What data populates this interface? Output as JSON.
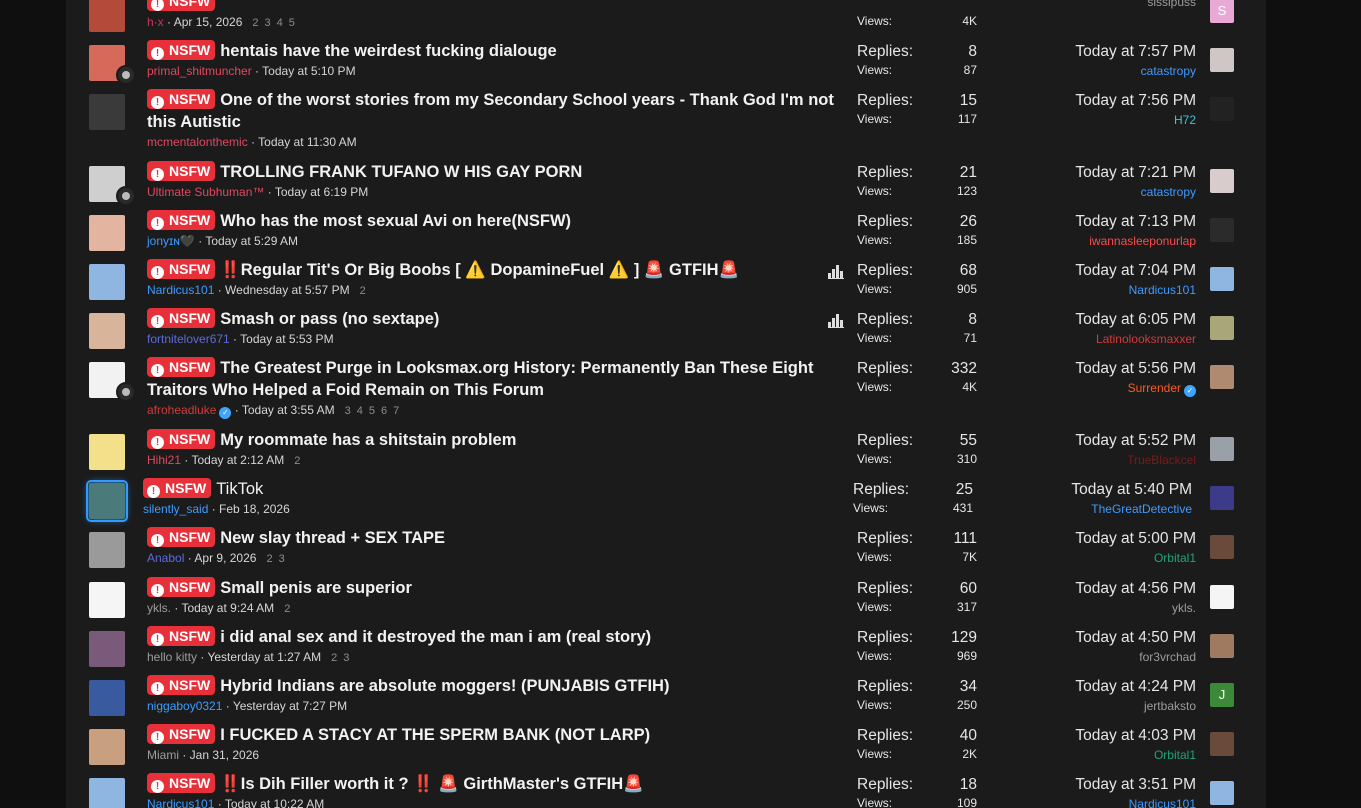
{
  "labels": {
    "tag": "NSFW",
    "replies": "Replies:",
    "views": "Views:"
  },
  "colors": {
    "tag_bg": "#e8303a",
    "accent_blue": "#3ea5ff"
  },
  "threads": [
    {
      "title": "",
      "author": "h·x",
      "author_color": "#c9355a",
      "started": "Apr 15, 2026",
      "pages": [
        "2",
        "3",
        "4",
        "5"
      ],
      "replies": "",
      "views": "4K",
      "last_time": "",
      "last_user": "sissipuss",
      "last_user_color": "#9c9c9c",
      "avatar_color": "#b34a3a",
      "last_avatar_color": "#e9a9d6",
      "last_avatar_letter": "S",
      "height": "h49"
    },
    {
      "title": "hentais have the weirdest fucking dialouge",
      "author": "primal_shitmuncher",
      "author_color": "#e0475f",
      "started": "Today at 5:10 PM",
      "pages": [],
      "replies": "8",
      "views": "87",
      "last_time": "Today at 7:57 PM",
      "last_user": "catastropy",
      "last_user_color": "#3e9bff",
      "avatar_color": "#d66a5a",
      "last_avatar_color": "#cfc6c6",
      "has_mini": true,
      "height": "h49"
    },
    {
      "title": "One of the worst stories from my Secondary School years - Thank God I'm not this Autistic",
      "author": "mcmentalonthemic",
      "author_color": "#e0475f",
      "started": "Today at 11:30 AM",
      "pages": [],
      "replies": "15",
      "views": "117",
      "last_time": "Today at 7:56 PM",
      "last_user": "H72",
      "last_user_color": "#3ec1d6",
      "avatar_color": "#3a3a3a",
      "last_avatar_color": "#222",
      "height": "h72"
    },
    {
      "title": "TROLLING FRANK TUFANO W HIS GAY PORN",
      "author": "Ultimate Subhuman™",
      "author_color": "#e0475f",
      "started": "Today at 6:19 PM",
      "pages": [],
      "replies": "21",
      "views": "123",
      "last_time": "Today at 7:21 PM",
      "last_user": "catastropy",
      "last_user_color": "#3e9bff",
      "avatar_color": "#cfcfcf",
      "last_avatar_color": "#d9cccc",
      "has_mini": true,
      "height": "h49"
    },
    {
      "title": "Who has the most sexual Avi on here(NSFW)",
      "author": "jonyɪɴ🖤",
      "author_color": "#3e9bff",
      "started": "Today at 5:29 AM",
      "pages": [],
      "replies": "26",
      "views": "185",
      "last_time": "Today at 7:13 PM",
      "last_user": "iwannasleeponurlap",
      "last_user_color": "#ff4a4a",
      "avatar_color": "#e3b4a0",
      "last_avatar_color": "#2b2b2b",
      "height": "h49"
    },
    {
      "title": "‼️Regular Tit's Or Big Boobs [ ⚠️ DopamineFuel ⚠️ ] 🚨 GTFIH🚨",
      "author": "Nardicus101",
      "author_color": "#3e9bff",
      "started": "Wednesday at 5:57 PM",
      "pages": [
        "2"
      ],
      "replies": "68",
      "views": "905",
      "last_time": "Today at 7:04 PM",
      "last_user": "Nardicus101",
      "last_user_color": "#3e9bff",
      "avatar_color": "#8fb6e0",
      "last_avatar_color": "#8fb6e0",
      "poll": true,
      "height": "h49"
    },
    {
      "title": "Smash or pass (no sextape)",
      "author": "fortnitelover671",
      "author_color": "#5d6bd9",
      "started": "Today at 5:53 PM",
      "pages": [],
      "replies": "8",
      "views": "71",
      "last_time": "Today at 6:05 PM",
      "last_user": "Latinolooksmaxxer",
      "last_user_color": "#d23a3a",
      "avatar_color": "#d8b49a",
      "last_avatar_color": "#a9a77a",
      "poll": true,
      "height": "h49"
    },
    {
      "title": "The Greatest Purge in Looksmax.org History: Permanently Ban These Eight Traitors Who Helped a Foid Remain on This Forum",
      "author": "afroheadluke",
      "author_color": "#d23a3a",
      "verified": true,
      "started": "Today at 3:55 AM",
      "pages": [
        "3",
        "4",
        "5",
        "6",
        "7"
      ],
      "replies": "332",
      "views": "4K",
      "last_time": "Today at 5:56 PM",
      "last_user": "Surrender",
      "last_user_color": "#ff5a1f",
      "last_verified": true,
      "avatar_color": "#f2f2f2",
      "last_avatar_color": "#b08a70",
      "has_mini": true,
      "height": "h72"
    },
    {
      "title": "My roommate has a shitstain problem",
      "author": "Hihi21",
      "author_color": "#e0475f",
      "started": "Today at 2:12 AM",
      "pages": [
        "2"
      ],
      "replies": "55",
      "views": "310",
      "last_time": "Today at 5:52 PM",
      "last_user": "TrueBlackcel",
      "last_user_color": "#7a1a1a",
      "avatar_color": "#f2e08a",
      "last_avatar_color": "#9aa0a8",
      "height": "h49"
    },
    {
      "title": "TikTok",
      "author": "silently_said",
      "author_color": "#3e9bff",
      "started": "Feb 18, 2026",
      "pages": [],
      "replies": "25",
      "views": "431",
      "last_time": "Today at 5:40 PM",
      "last_user": "TheGreatDetective",
      "last_user_color": "#3e9bff",
      "avatar_color": "#4a7a7a",
      "last_avatar_color": "#3b3b8a",
      "focus": true,
      "plain_title": true,
      "height": "h49"
    },
    {
      "title": "New slay thread + SEX TAPE",
      "author": "Anabol",
      "author_color": "#5d6bd9",
      "started": "Apr 9, 2026",
      "pages": [
        "2",
        "3"
      ],
      "replies": "111",
      "views": "7K",
      "last_time": "Today at 5:00 PM",
      "last_user": "Orbital1",
      "last_user_color": "#1fa37a",
      "avatar_color": "#9a9a9a",
      "last_avatar_color": "#6a4a3a",
      "height": "h50"
    },
    {
      "title": "Small penis are superior",
      "author": "ykls.",
      "author_color": "#9c9c9c",
      "started": "Today at 9:24 AM",
      "pages": [
        "2"
      ],
      "replies": "60",
      "views": "317",
      "last_time": "Today at 4:56 PM",
      "last_user": "ykls.",
      "last_user_color": "#9c9c9c",
      "avatar_color": "#f5f5f5",
      "last_avatar_color": "#f5f5f5",
      "height": "h49"
    },
    {
      "title": "i did anal sex and it destroyed the man i am (real story)",
      "author": "hello kitty",
      "author_color": "#9c9c9c",
      "started": "Yesterday at 1:27 AM",
      "pages": [
        "2",
        "3"
      ],
      "replies": "129",
      "views": "969",
      "last_time": "Today at 4:50 PM",
      "last_user": "for3vrchad",
      "last_user_color": "#9c9c9c",
      "avatar_color": "#7a5a7a",
      "last_avatar_color": "#a07a60",
      "height": "h49"
    },
    {
      "title": "Hybrid Indians are absolute moggers! (PUNJABIS GTFIH)",
      "author": "niggaboy0321",
      "author_color": "#3e9bff",
      "started": "Yesterday at 7:27 PM",
      "pages": [],
      "replies": "34",
      "views": "250",
      "last_time": "Today at 4:24 PM",
      "last_user": "jertbaksto",
      "last_user_color": "#9c9c9c",
      "avatar_color": "#3a5aa0",
      "last_avatar_color": "#3a8a3a",
      "last_avatar_letter": "J",
      "height": "h49"
    },
    {
      "title": "I FUCKED A STACY AT THE SPERM BANK (NOT LARP)",
      "author": "Miami",
      "author_color": "#9c9c9c",
      "started": "Jan 31, 2026",
      "pages": [],
      "replies": "40",
      "views": "2K",
      "last_time": "Today at 4:03 PM",
      "last_user": "Orbital1",
      "last_user_color": "#1fa37a",
      "avatar_color": "#c8a080",
      "last_avatar_color": "#6a4a3a",
      "height": "h49"
    },
    {
      "title": "‼️Is Dih Filler worth it ? ‼️ 🚨 GirthMaster's GTFIH🚨",
      "author": "Nardicus101",
      "author_color": "#3e9bff",
      "started": "Today at 10:22 AM",
      "pages": [],
      "replies": "18",
      "views": "109",
      "last_time": "Today at 3:51 PM",
      "last_user": "Nardicus101",
      "last_user_color": "#3e9bff",
      "avatar_color": "#8fb6e0",
      "last_avatar_color": "#8fb6e0",
      "height": "h49"
    }
  ]
}
